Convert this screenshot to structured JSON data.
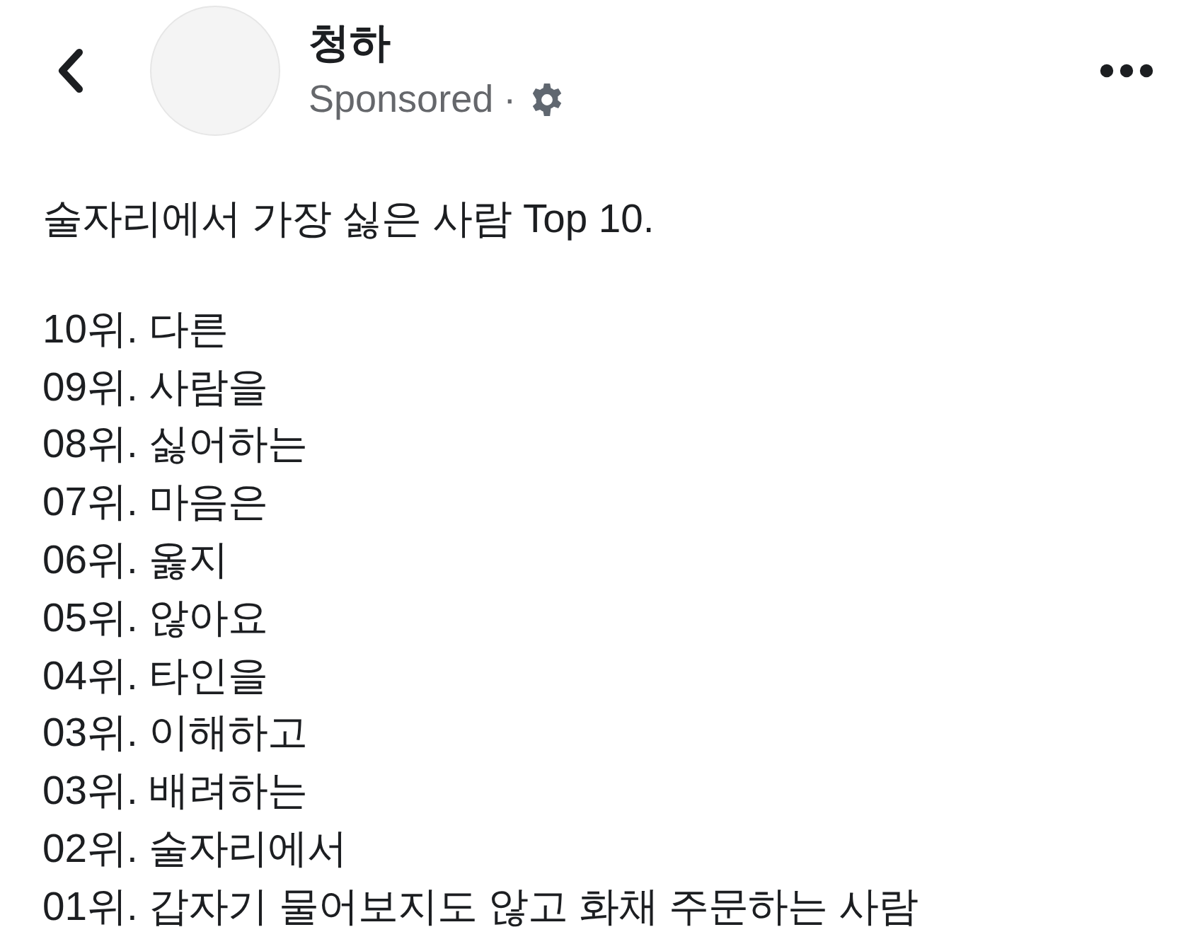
{
  "header": {
    "page_name": "청하",
    "sponsored_label": "Sponsored",
    "separator": "·"
  },
  "post": {
    "title": "술자리에서 가장 싫은 사람 Top 10.",
    "lines": [
      "10위. 다른",
      "09위. 사람을",
      "08위. 싫어하는",
      "07위. 마음은",
      "06위. 옳지",
      "05위. 않아요",
      "04위. 타인을",
      "03위. 이해하고",
      "03위. 배려하는",
      "02위. 술자리에서",
      "01위. 갑자기 물어보지도 않고 화채 주문하는 사람"
    ]
  }
}
